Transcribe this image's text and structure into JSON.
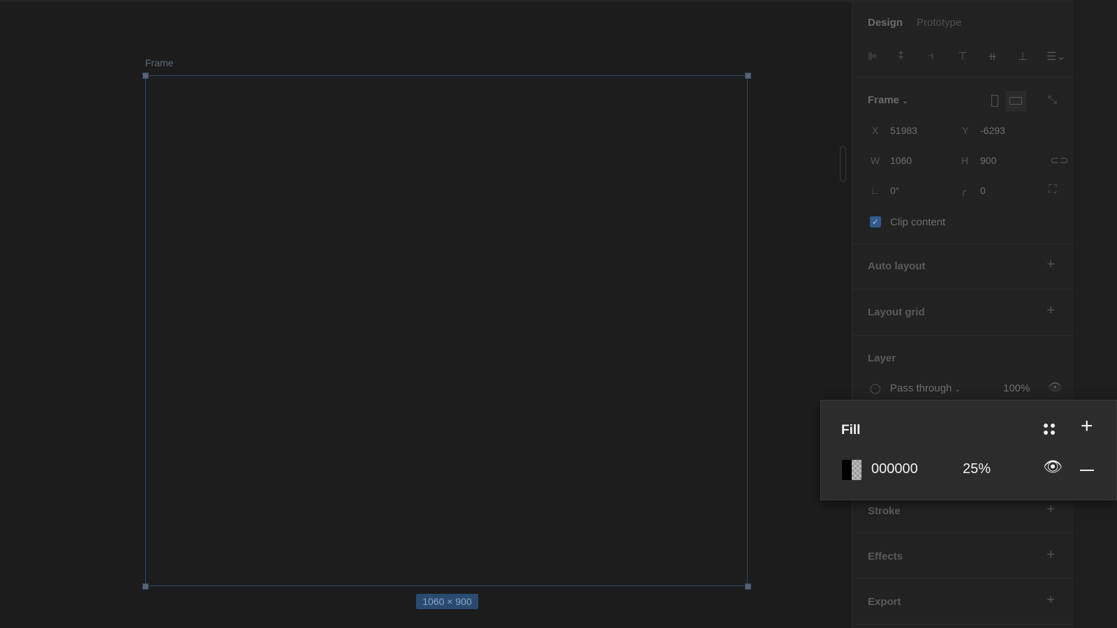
{
  "canvas": {
    "frame_label": "Frame",
    "size_badge": "1060 × 900"
  },
  "panel": {
    "tabs": [
      {
        "label": "Design"
      },
      {
        "label": "Prototype"
      }
    ],
    "frame": {
      "title": "Frame",
      "x_label": "X",
      "x": "51983",
      "y_label": "Y",
      "y": "-6293",
      "w_label": "W",
      "w": "1060",
      "h_label": "H",
      "h": "900",
      "rotation": "0°",
      "radius": "0",
      "clip_label": "Clip content",
      "clip_checked": true
    },
    "sections": {
      "auto_layout": "Auto layout",
      "layout_grid": "Layout grid",
      "layer": "Layer",
      "stroke": "Stroke",
      "effects": "Effects",
      "export": "Export"
    },
    "layer": {
      "blend": "Pass through",
      "opacity": "100%"
    }
  },
  "fill": {
    "title": "Fill",
    "color": "000000",
    "opacity": "25%"
  },
  "colors": {
    "accent": "#2a4a72",
    "checkbox": "#2f5a8a"
  }
}
